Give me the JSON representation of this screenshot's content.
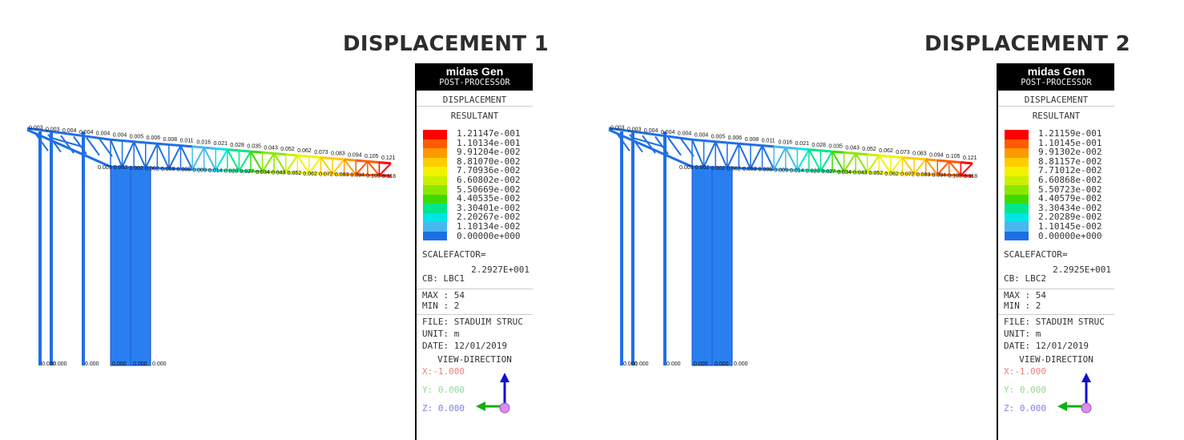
{
  "panels": [
    {
      "title": "DISPLACEMENT 1",
      "legend": {
        "app": "midas Gen",
        "module": "POST-PROCESSOR",
        "result_type": "DISPLACEMENT",
        "component": "RESULTANT",
        "values": [
          "1.21147e-001",
          "1.10134e-001",
          "9.91204e-002",
          "8.81070e-002",
          "7.70936e-002",
          "6.60802e-002",
          "5.50669e-002",
          "4.40535e-002",
          "3.30401e-002",
          "2.20267e-002",
          "1.10134e-002",
          "0.00000e+000"
        ],
        "scalefactor_label": "SCALEFACTOR=",
        "scalefactor": "2.2927E+001",
        "cb": "CB: LBC1",
        "max": "MAX : 54",
        "min": "MIN : 2",
        "file": "FILE: STADUIM STRUC",
        "unit": "UNIT: m",
        "date": "DATE: 12/01/2019",
        "view_direction": "VIEW-DIRECTION",
        "x": "X:-1.000",
        "y": "Y: 0.000",
        "z": "Z: 0.000"
      },
      "top_labels": [
        "0.003",
        "0.003",
        "0.004",
        "0.004",
        "0.004",
        "0.004",
        "0.005",
        "0.006",
        "0.008",
        "0.011",
        "0.016",
        "0.021",
        "0.028",
        "0.035",
        "0.043",
        "0.052",
        "0.062",
        "0.073",
        "0.083",
        "0.094",
        "0.105",
        "0.121"
      ],
      "bottom_labels": [
        "0.003",
        "0.002",
        "0.002",
        "0.002",
        "0.003",
        "0.005",
        "0.009",
        "0.014",
        "0.020",
        "0.027",
        "0.034",
        "0.043",
        "0.052",
        "0.062",
        "0.072",
        "0.083",
        "0.094",
        "0.105",
        "0.118"
      ],
      "base_labels": [
        "0.000",
        "0.000",
        "0.000",
        "0.000",
        "0.000",
        "0.000"
      ]
    },
    {
      "title": "DISPLACEMENT 2",
      "legend": {
        "app": "midas Gen",
        "module": "POST-PROCESSOR",
        "result_type": "DISPLACEMENT",
        "component": "RESULTANT",
        "values": [
          "1.21159e-001",
          "1.10145e-001",
          "9.91302e-002",
          "8.81157e-002",
          "7.71012e-002",
          "6.60868e-002",
          "5.50723e-002",
          "4.40579e-002",
          "3.30434e-002",
          "2.20289e-002",
          "1.10145e-002",
          "0.00000e+000"
        ],
        "scalefactor_label": "SCALEFACTOR=",
        "scalefactor": "2.2925E+001",
        "cb": "CB: LBC2",
        "max": "MAX : 54",
        "min": "MIN : 2",
        "file": "FILE: STADUIM STRUC",
        "unit": "UNIT: m",
        "date": "DATE: 12/01/2019",
        "view_direction": "VIEW-DIRECTION",
        "x": "X:-1.000",
        "y": "Y: 0.000",
        "z": "Z: 0.000"
      },
      "top_labels": [
        "0.003",
        "0.003",
        "0.004",
        "0.004",
        "0.004",
        "0.004",
        "0.005",
        "0.006",
        "0.008",
        "0.011",
        "0.016",
        "0.021",
        "0.028",
        "0.035",
        "0.043",
        "0.052",
        "0.062",
        "0.073",
        "0.083",
        "0.094",
        "0.105",
        "0.121"
      ],
      "bottom_labels": [
        "0.003",
        "0.002",
        "0.002",
        "0.002",
        "0.003",
        "0.005",
        "0.009",
        "0.014",
        "0.020",
        "0.027",
        "0.034",
        "0.043",
        "0.052",
        "0.062",
        "0.072",
        "0.083",
        "0.094",
        "0.105",
        "0.118"
      ],
      "base_labels": [
        "0.000",
        "0.000",
        "0.000",
        "0.000",
        "0.000",
        "0.000"
      ]
    }
  ],
  "colors": {
    "scale": [
      "#ff0000",
      "#ff5a00",
      "#ff9900",
      "#ffcc00",
      "#f2f200",
      "#c8f000",
      "#8ce600",
      "#3cdc00",
      "#00e68c",
      "#00e6e6",
      "#48b8f0",
      "#1e6ee6"
    ],
    "structure": "#1f6fe6",
    "column_fill": "#2a7ff0"
  },
  "axes_icon": "xyz-triad-icon"
}
